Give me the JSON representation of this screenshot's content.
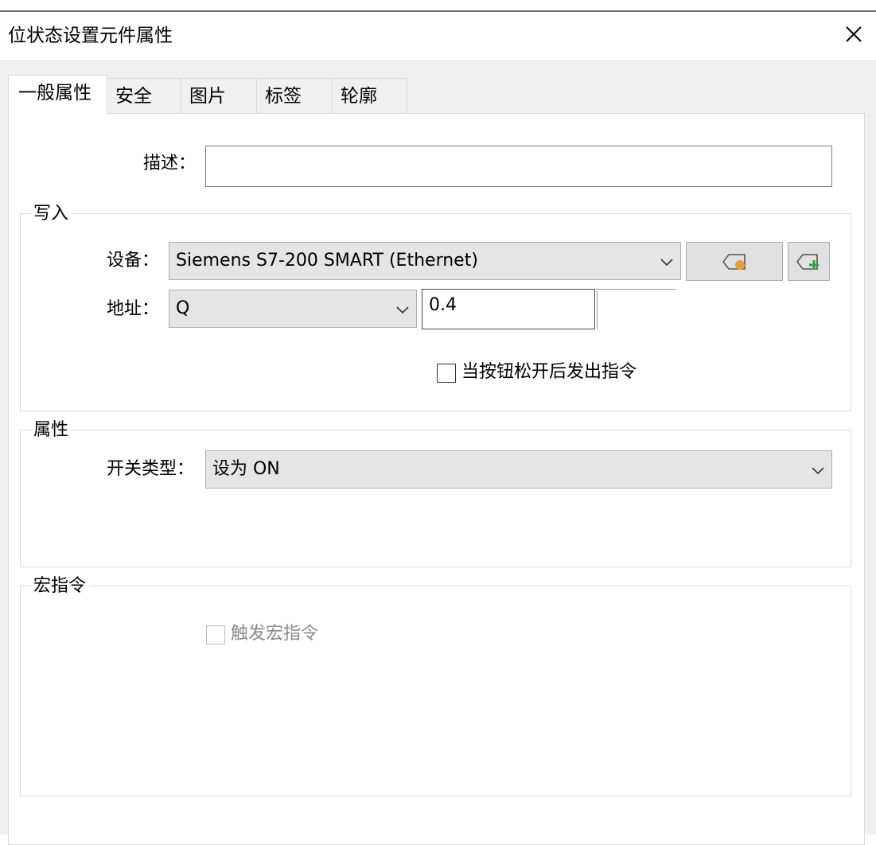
{
  "window": {
    "title": "位状态设置元件属性"
  },
  "tabs": [
    {
      "label": "一般属性",
      "active": true
    },
    {
      "label": "安全",
      "active": false
    },
    {
      "label": "图片",
      "active": false
    },
    {
      "label": "标签",
      "active": false
    },
    {
      "label": "轮廓",
      "active": false
    }
  ],
  "general": {
    "description_label": "描述：",
    "description_value": ""
  },
  "write": {
    "legend": "写入",
    "device_label": "设备：",
    "device_value": "Siemens S7-200 SMART (Ethernet)",
    "address_label": "地址：",
    "address_type": "Q",
    "address_value": "0.4",
    "release_checkbox_label": "当按钮松开后发出指令",
    "release_checked": false
  },
  "properties": {
    "legend": "属性",
    "switch_type_label": "开关类型：",
    "switch_type_value": "设为 ON"
  },
  "macro": {
    "legend": "宏指令",
    "trigger_label": "触发宏指令",
    "trigger_checked": false,
    "trigger_enabled": false
  },
  "colors": {
    "dialog_bg": "#f0f0f0",
    "panel_bg": "#ffffff",
    "combo_bg": "#e5e5e5",
    "tag_dot": "#e0a040",
    "tag_plus": "#2ea043"
  },
  "icons": {
    "close": "close-icon",
    "tag_settings": "tag-icon",
    "tag_add": "tag-add-icon",
    "dropdown": "chevron-down-icon"
  }
}
